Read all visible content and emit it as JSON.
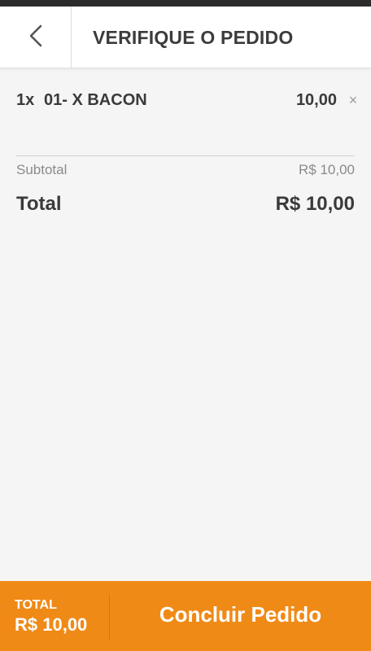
{
  "header": {
    "title": "VERIFIQUE O PEDIDO",
    "back_icon": "chevron-left-icon"
  },
  "order": {
    "items": [
      {
        "qty": "1x",
        "name": "01- X BACON",
        "price": "10,00",
        "remove_symbol": "×"
      }
    ],
    "subtotal_label": "Subtotal",
    "subtotal_value": "R$ 10,00",
    "total_label": "Total",
    "total_value": "R$ 10,00"
  },
  "footer": {
    "total_label": "TOTAL",
    "total_value": "R$ 10,00",
    "confirm_label": "Concluir Pedido"
  },
  "colors": {
    "accent": "#f08a16",
    "header_bg": "#ffffff",
    "page_bg": "#f5f5f5",
    "text": "#3a3a3a",
    "muted": "#8a8a8a"
  }
}
